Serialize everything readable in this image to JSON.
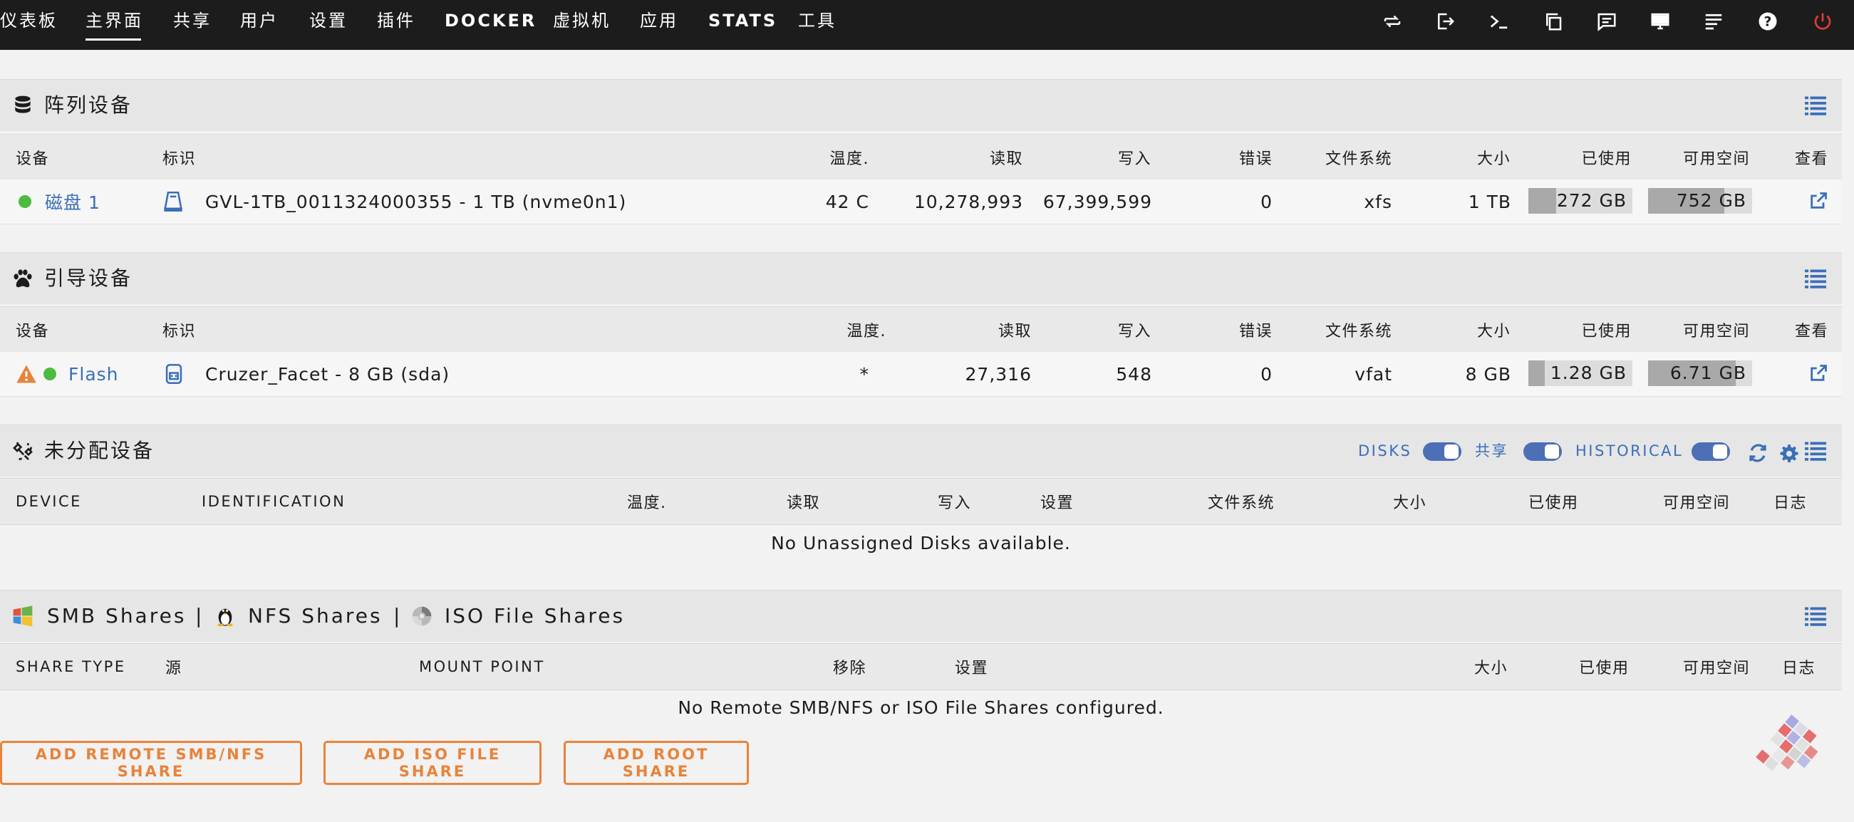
{
  "nav": {
    "items": [
      "仪表板",
      "主界面",
      "共享",
      "用户",
      "设置",
      "插件",
      "DOCKER",
      "虚拟机",
      "应用",
      "STATS",
      "工具"
    ],
    "active": "主界面"
  },
  "top_icons": [
    "switch-icon",
    "logout-icon",
    "terminal-icon",
    "copy-icon",
    "feedback-icon",
    "monitor-icon",
    "log-icon",
    "help-icon",
    "power-icon"
  ],
  "array": {
    "title": "阵列设备",
    "columns": [
      "设备",
      "标识",
      "温度.",
      "读取",
      "写入",
      "错误",
      "文件系统",
      "大小",
      "已使用",
      "可用空间",
      "查看"
    ],
    "row": {
      "device": "磁盘 1",
      "identification": "GVL-1TB_0011324000355 - 1 TB (nvme0n1)",
      "temp": "42 C",
      "reads": "10,278,993",
      "writes": "67,399,599",
      "errors": "0",
      "fs": "xfs",
      "size": "1 TB",
      "used": "272 GB",
      "used_fraction": 0.27,
      "free": "752 GB",
      "free_fraction": 0.73
    }
  },
  "boot": {
    "title": "引导设备",
    "columns": [
      "设备",
      "标识",
      "温度.",
      "读取",
      "写入",
      "错误",
      "文件系统",
      "大小",
      "已使用",
      "可用空间",
      "查看"
    ],
    "row": {
      "device": "Flash",
      "identification": "Cruzer_Facet - 8 GB (sda)",
      "temp": "*",
      "reads": "27,316",
      "writes": "548",
      "errors": "0",
      "fs": "vfat",
      "size": "8 GB",
      "used": "1.28 GB",
      "used_fraction": 0.16,
      "free": "6.71 GB",
      "free_fraction": 0.84
    }
  },
  "unassigned": {
    "title": "未分配设备",
    "toggles": [
      "DISKS",
      "共享",
      "HISTORICAL"
    ],
    "columns": [
      "DEVICE",
      "IDENTIFICATION",
      "温度.",
      "读取",
      "写入",
      "设置",
      "文件系统",
      "大小",
      "已使用",
      "可用空间",
      "日志"
    ],
    "empty": "No Unassigned Disks available."
  },
  "shares": {
    "title_smb": "SMB Shares",
    "sep": "|",
    "title_nfs": "NFS Shares",
    "title_iso": "ISO File Shares",
    "columns": [
      "SHARE TYPE",
      "源",
      "MOUNT POINT",
      "移除",
      "设置",
      "大小",
      "已使用",
      "可用空间",
      "日志"
    ],
    "empty": "No Remote SMB/NFS or ISO File Shares configured.",
    "buttons": [
      "ADD REMOTE SMB/NFS SHARE",
      "ADD ISO FILE SHARE",
      "ADD ROOT SHARE"
    ]
  },
  "colors": {
    "accent": "#e8833a",
    "link": "#3a6fb8",
    "status_ok": "#4cbb3f",
    "warning": "#e8833a"
  }
}
